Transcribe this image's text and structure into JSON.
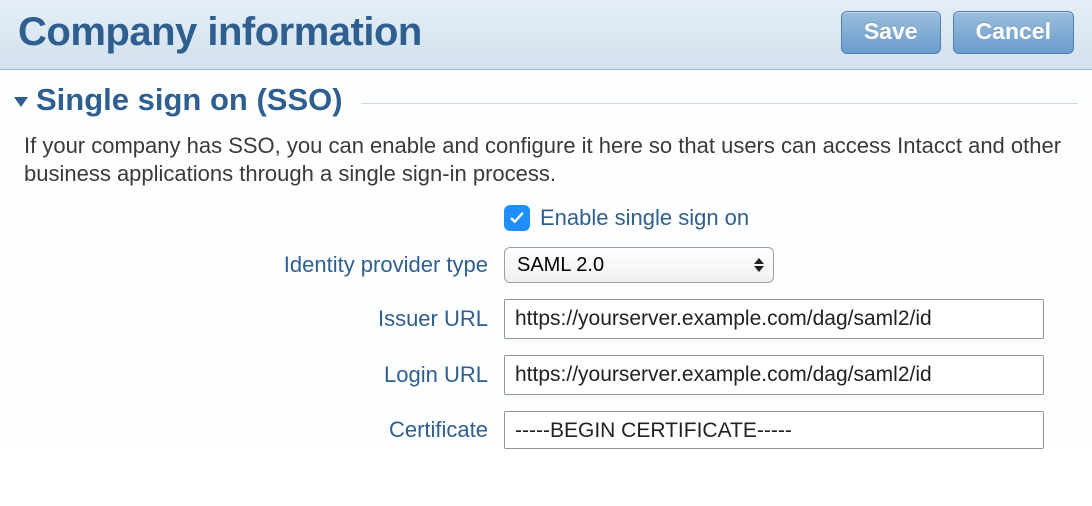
{
  "header": {
    "title": "Company information",
    "save_label": "Save",
    "cancel_label": "Cancel"
  },
  "section": {
    "title": "Single sign on (SSO)",
    "description": "If your company has SSO, you can enable and configure it here so that users can access Intacct and other business applications through a single sign-in process."
  },
  "form": {
    "enable_label": "Enable single sign on",
    "enable_checked": true,
    "idp_type_label": "Identity provider type",
    "idp_type_value": "SAML 2.0",
    "issuer_label": "Issuer URL",
    "issuer_value": "https://yourserver.example.com/dag/saml2/id",
    "login_label": "Login URL",
    "login_value": "https://yourserver.example.com/dag/saml2/id",
    "cert_label": "Certificate",
    "cert_value": "-----BEGIN CERTIFICATE-----"
  }
}
